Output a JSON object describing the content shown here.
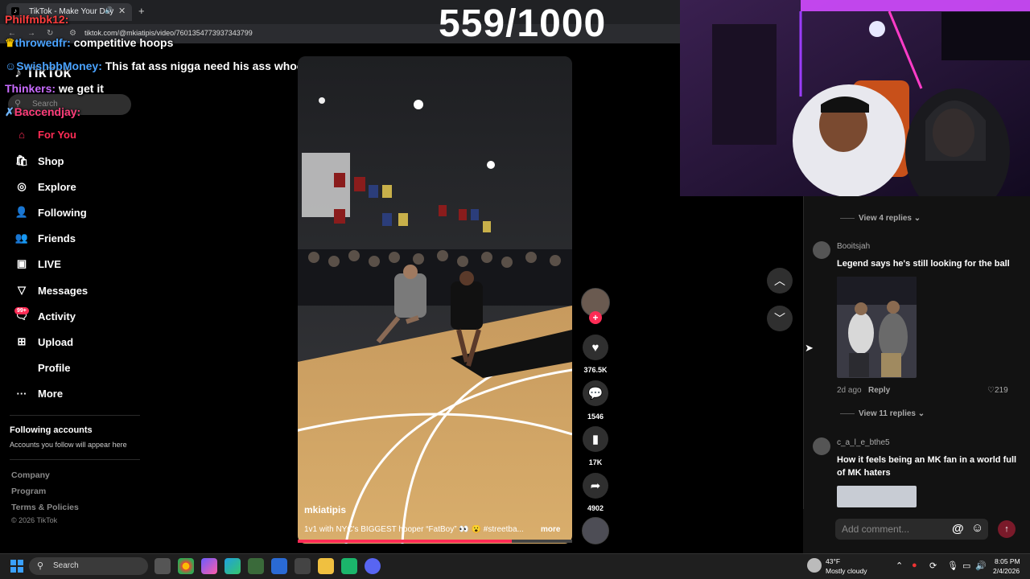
{
  "browser": {
    "tab_title": "TikTok - Make Your Day",
    "url": "tiktok.com/@mkiatipis/video/7601354773937343799"
  },
  "stream": {
    "counter": "559/1000"
  },
  "chat": [
    {
      "user": "Philfmbk12:",
      "text": "",
      "color": "#ff3d3d"
    },
    {
      "user": "throwedfr:",
      "text": "competitive hoops",
      "color": "#4aa3ff"
    },
    {
      "user": "SwishbbMoney:",
      "text": "This fat ass nigga need his ass whooped",
      "color": "#4aa3ff"
    },
    {
      "user": "Thinkers:",
      "text": "we get it",
      "color": "#c86bff"
    },
    {
      "user": "Baccendjay:",
      "text": "",
      "color": "#ff3d7a"
    }
  ],
  "sidebar": {
    "logo": "TikTok",
    "search_placeholder": "Search",
    "items": [
      {
        "label": "For You",
        "icon": "home-icon"
      },
      {
        "label": "Shop",
        "icon": "shop-icon"
      },
      {
        "label": "Explore",
        "icon": "compass-icon"
      },
      {
        "label": "Following",
        "icon": "following-icon"
      },
      {
        "label": "Friends",
        "icon": "friends-icon"
      },
      {
        "label": "LIVE",
        "icon": "live-icon"
      },
      {
        "label": "Messages",
        "icon": "messages-icon"
      },
      {
        "label": "Activity",
        "icon": "activity-icon"
      },
      {
        "label": "Upload",
        "icon": "upload-icon"
      },
      {
        "label": "Profile",
        "icon": "profile-icon"
      },
      {
        "label": "More",
        "icon": "more-icon"
      }
    ],
    "activity_badge": "99+",
    "following_title": "Following accounts",
    "following_sub": "Accounts you follow will appear here",
    "footer": [
      "Company",
      "Program",
      "Terms & Policies"
    ],
    "copyright": "© 2026 TikTok"
  },
  "video": {
    "username": "mkiatipis",
    "description": "1v1 with NYC's BIGGEST hooper “FatBoy” 👀 😮 #streetba...",
    "more_label": "more",
    "progress": 0.78,
    "likes": "376.5K",
    "comments": "1546",
    "saves": "17K",
    "shares": "4902"
  },
  "comments": {
    "view_replies_top": "View 4 replies",
    "items": [
      {
        "user": "Booitsjah",
        "text": "Legend says he's still looking for the ball",
        "age": "2d ago",
        "reply": "Reply",
        "likes": "219",
        "view_replies": "View 11 replies"
      },
      {
        "user": "c_a_l_e_bthe5",
        "text": "How it feels being an MK fan in a world full of MK haters"
      }
    ],
    "input_placeholder": "Add comment..."
  },
  "taskbar": {
    "search": "Search",
    "weather_temp": "43°F",
    "weather_desc": "Mostly cloudy",
    "time": "8:05 PM",
    "date": "2/4/2026"
  }
}
